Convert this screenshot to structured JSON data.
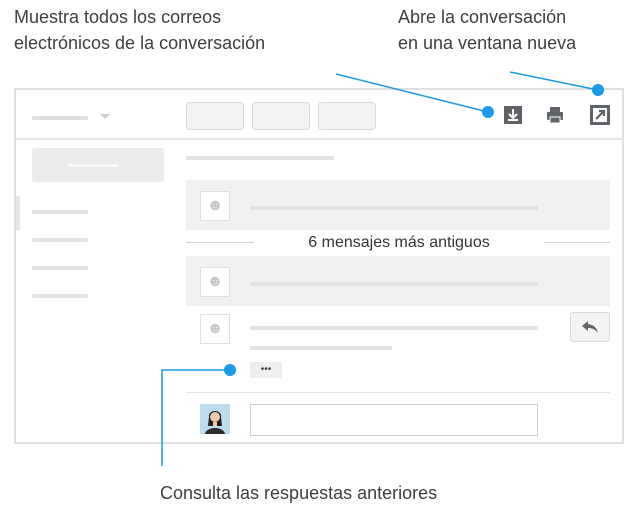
{
  "captions": {
    "top_left_line1": "Muestra todos los correos",
    "top_left_line2": "electrónicos de la conversación",
    "top_right_line1": "Abre la conversación",
    "top_right_line2": "en una ventana nueva",
    "bottom": "Consulta las respuestas anteriores"
  },
  "thread": {
    "older_messages_label": "6 mensajes más antiguos",
    "collapsed_indicator": "•••"
  },
  "icons": {
    "expand_all": "download-box-icon",
    "print": "printer-icon",
    "new_window": "open-in-new-icon",
    "reply": "reply-arrow-icon",
    "user_avatar": "person-avatar-icon",
    "profile_photo": "profile-photo-icon"
  },
  "colors": {
    "callout_blue": "#1a9ae8",
    "icon_dark": "#5f6368"
  }
}
